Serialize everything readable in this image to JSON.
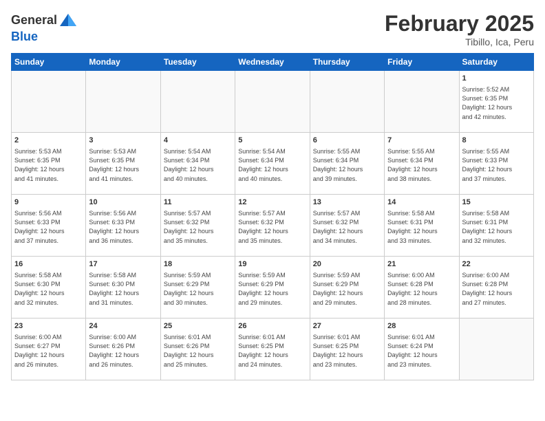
{
  "header": {
    "logo_general": "General",
    "logo_blue": "Blue",
    "month_title": "February 2025",
    "location": "Tibillo, Ica, Peru"
  },
  "days_of_week": [
    "Sunday",
    "Monday",
    "Tuesday",
    "Wednesday",
    "Thursday",
    "Friday",
    "Saturday"
  ],
  "weeks": [
    [
      {
        "day": "",
        "info": ""
      },
      {
        "day": "",
        "info": ""
      },
      {
        "day": "",
        "info": ""
      },
      {
        "day": "",
        "info": ""
      },
      {
        "day": "",
        "info": ""
      },
      {
        "day": "",
        "info": ""
      },
      {
        "day": "1",
        "info": "Sunrise: 5:52 AM\nSunset: 6:35 PM\nDaylight: 12 hours\nand 42 minutes."
      }
    ],
    [
      {
        "day": "2",
        "info": "Sunrise: 5:53 AM\nSunset: 6:35 PM\nDaylight: 12 hours\nand 41 minutes."
      },
      {
        "day": "3",
        "info": "Sunrise: 5:53 AM\nSunset: 6:35 PM\nDaylight: 12 hours\nand 41 minutes."
      },
      {
        "day": "4",
        "info": "Sunrise: 5:54 AM\nSunset: 6:34 PM\nDaylight: 12 hours\nand 40 minutes."
      },
      {
        "day": "5",
        "info": "Sunrise: 5:54 AM\nSunset: 6:34 PM\nDaylight: 12 hours\nand 40 minutes."
      },
      {
        "day": "6",
        "info": "Sunrise: 5:55 AM\nSunset: 6:34 PM\nDaylight: 12 hours\nand 39 minutes."
      },
      {
        "day": "7",
        "info": "Sunrise: 5:55 AM\nSunset: 6:34 PM\nDaylight: 12 hours\nand 38 minutes."
      },
      {
        "day": "8",
        "info": "Sunrise: 5:55 AM\nSunset: 6:33 PM\nDaylight: 12 hours\nand 37 minutes."
      }
    ],
    [
      {
        "day": "9",
        "info": "Sunrise: 5:56 AM\nSunset: 6:33 PM\nDaylight: 12 hours\nand 37 minutes."
      },
      {
        "day": "10",
        "info": "Sunrise: 5:56 AM\nSunset: 6:33 PM\nDaylight: 12 hours\nand 36 minutes."
      },
      {
        "day": "11",
        "info": "Sunrise: 5:57 AM\nSunset: 6:32 PM\nDaylight: 12 hours\nand 35 minutes."
      },
      {
        "day": "12",
        "info": "Sunrise: 5:57 AM\nSunset: 6:32 PM\nDaylight: 12 hours\nand 35 minutes."
      },
      {
        "day": "13",
        "info": "Sunrise: 5:57 AM\nSunset: 6:32 PM\nDaylight: 12 hours\nand 34 minutes."
      },
      {
        "day": "14",
        "info": "Sunrise: 5:58 AM\nSunset: 6:31 PM\nDaylight: 12 hours\nand 33 minutes."
      },
      {
        "day": "15",
        "info": "Sunrise: 5:58 AM\nSunset: 6:31 PM\nDaylight: 12 hours\nand 32 minutes."
      }
    ],
    [
      {
        "day": "16",
        "info": "Sunrise: 5:58 AM\nSunset: 6:30 PM\nDaylight: 12 hours\nand 32 minutes."
      },
      {
        "day": "17",
        "info": "Sunrise: 5:58 AM\nSunset: 6:30 PM\nDaylight: 12 hours\nand 31 minutes."
      },
      {
        "day": "18",
        "info": "Sunrise: 5:59 AM\nSunset: 6:29 PM\nDaylight: 12 hours\nand 30 minutes."
      },
      {
        "day": "19",
        "info": "Sunrise: 5:59 AM\nSunset: 6:29 PM\nDaylight: 12 hours\nand 29 minutes."
      },
      {
        "day": "20",
        "info": "Sunrise: 5:59 AM\nSunset: 6:29 PM\nDaylight: 12 hours\nand 29 minutes."
      },
      {
        "day": "21",
        "info": "Sunrise: 6:00 AM\nSunset: 6:28 PM\nDaylight: 12 hours\nand 28 minutes."
      },
      {
        "day": "22",
        "info": "Sunrise: 6:00 AM\nSunset: 6:28 PM\nDaylight: 12 hours\nand 27 minutes."
      }
    ],
    [
      {
        "day": "23",
        "info": "Sunrise: 6:00 AM\nSunset: 6:27 PM\nDaylight: 12 hours\nand 26 minutes."
      },
      {
        "day": "24",
        "info": "Sunrise: 6:00 AM\nSunset: 6:26 PM\nDaylight: 12 hours\nand 26 minutes."
      },
      {
        "day": "25",
        "info": "Sunrise: 6:01 AM\nSunset: 6:26 PM\nDaylight: 12 hours\nand 25 minutes."
      },
      {
        "day": "26",
        "info": "Sunrise: 6:01 AM\nSunset: 6:25 PM\nDaylight: 12 hours\nand 24 minutes."
      },
      {
        "day": "27",
        "info": "Sunrise: 6:01 AM\nSunset: 6:25 PM\nDaylight: 12 hours\nand 23 minutes."
      },
      {
        "day": "28",
        "info": "Sunrise: 6:01 AM\nSunset: 6:24 PM\nDaylight: 12 hours\nand 23 minutes."
      },
      {
        "day": "",
        "info": ""
      }
    ]
  ]
}
